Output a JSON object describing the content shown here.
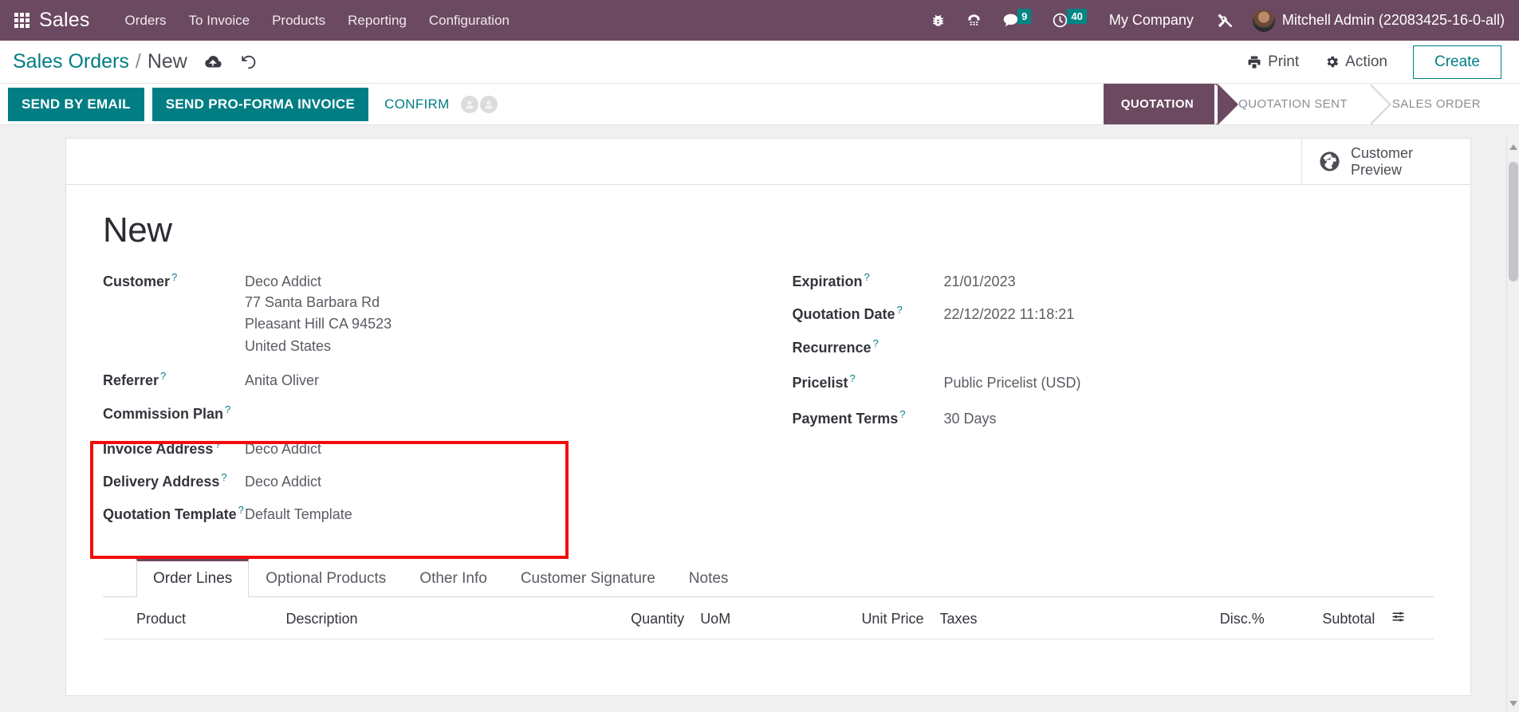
{
  "navbar": {
    "apps_icon": "apps-grid-icon",
    "brand": "Sales",
    "menu": [
      {
        "label": "Orders"
      },
      {
        "label": "To Invoice"
      },
      {
        "label": "Products"
      },
      {
        "label": "Reporting"
      },
      {
        "label": "Configuration"
      }
    ],
    "icons": [
      {
        "name": "bug-icon",
        "badge": ""
      },
      {
        "name": "phone-keypad-icon",
        "badge": ""
      },
      {
        "name": "chat-bubble-icon",
        "badge": "9"
      },
      {
        "name": "clock-activity-icon",
        "badge": "40"
      }
    ],
    "company": "My Company",
    "tools_icon": "tools-wrench-icon",
    "user": "Mitchell Admin (22083425-16-0-all)",
    "accent_bg": "#6b4a61",
    "badge_color": "#008784"
  },
  "breadcrumb": {
    "root": "Sales Orders",
    "separator": "/",
    "current": "New",
    "save_icon": "cloud-upload-save-icon",
    "discard_icon": "undo-discard-icon"
  },
  "control_panel": {
    "print_label": "Print",
    "action_label": "Action",
    "create_label": "Create"
  },
  "statusbar": {
    "buttons": [
      {
        "label": "SEND BY EMAIL",
        "style": "primary"
      },
      {
        "label": "SEND PRO-FORMA INVOICE",
        "style": "primary"
      },
      {
        "label": "CONFIRM",
        "style": "link"
      }
    ],
    "followers_count": 2,
    "stages": [
      {
        "label": "QUOTATION",
        "active": true
      },
      {
        "label": "QUOTATION SENT",
        "active": false
      },
      {
        "label": "SALES ORDER",
        "active": false
      }
    ],
    "active_color": "#6b4a61",
    "primary_color": "#017e84"
  },
  "stat_button": {
    "icon": "globe-icon",
    "line1": "Customer",
    "line2": "Preview"
  },
  "form": {
    "title": "New",
    "left_fields": [
      {
        "label": "Customer",
        "help": "?",
        "value": "Deco Addict",
        "address": [
          "77 Santa Barbara Rd",
          "Pleasant Hill CA 94523",
          "United States"
        ]
      },
      {
        "label": "Referrer",
        "help": "?",
        "value": "Anita Oliver",
        "address": []
      },
      {
        "label": "Commission Plan",
        "help": "?",
        "value": "",
        "address": []
      },
      {
        "label": "Invoice Address",
        "help": "?",
        "value": "Deco Addict",
        "address": []
      },
      {
        "label": "Delivery Address",
        "help": "?",
        "value": "Deco Addict",
        "address": []
      },
      {
        "label": "Quotation Template",
        "help": "?",
        "value": "Default Template",
        "address": []
      }
    ],
    "right_fields": [
      {
        "label": "Expiration",
        "help": "?",
        "value": "21/01/2023"
      },
      {
        "label": "Quotation Date",
        "help": "?",
        "value": "22/12/2022 11:18:21"
      },
      {
        "label": "Recurrence",
        "help": "?",
        "value": ""
      },
      {
        "label": "Pricelist",
        "help": "?",
        "value": "Public Pricelist (USD)"
      },
      {
        "label": "Payment Terms",
        "help": "?",
        "value": "30 Days"
      }
    ],
    "annotation": {
      "color": "#f20d0d",
      "covers": "Invoice Address, Delivery Address, Quotation Template"
    }
  },
  "notebook": {
    "tabs": [
      {
        "label": "Order Lines",
        "active": true
      },
      {
        "label": "Optional Products",
        "active": false
      },
      {
        "label": "Other Info",
        "active": false
      },
      {
        "label": "Customer Signature",
        "active": false
      },
      {
        "label": "Notes",
        "active": false
      }
    ],
    "columns": [
      {
        "label": "Product",
        "align": "left"
      },
      {
        "label": "Description",
        "align": "left"
      },
      {
        "label": "Quantity",
        "align": "right"
      },
      {
        "label": "UoM",
        "align": "left"
      },
      {
        "label": "Unit Price",
        "align": "right"
      },
      {
        "label": "Taxes",
        "align": "left"
      },
      {
        "label": "Disc.%",
        "align": "right"
      },
      {
        "label": "Subtotal",
        "align": "right"
      }
    ],
    "optional_columns_icon": "column-options-sliders-icon",
    "rows": []
  }
}
